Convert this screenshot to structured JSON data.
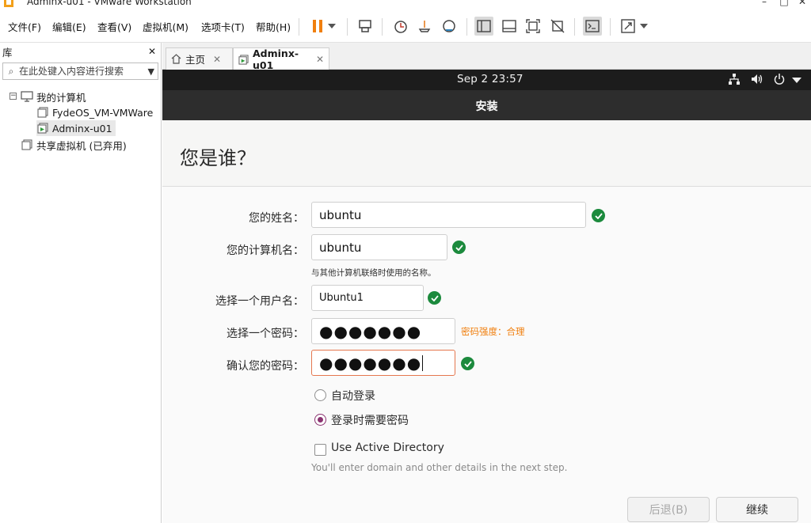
{
  "window": {
    "title": "Adminx-u01 - VMware Workstation",
    "minimize": "–",
    "maximize": "□",
    "close": "✕"
  },
  "menubar": {
    "items": [
      {
        "label": "文件(F)"
      },
      {
        "label": "编辑(E)"
      },
      {
        "label": "查看(V)"
      },
      {
        "label": "虚拟机(M)"
      },
      {
        "label": "选项卡(T)"
      },
      {
        "label": "帮助(H)"
      }
    ]
  },
  "library": {
    "title": "库",
    "close": "✕",
    "search_placeholder": "在此处键入内容进行搜索",
    "tree": {
      "root": "我的计算机",
      "vms": [
        "FydeOS_VM-VMWare",
        "Adminx-u01"
      ],
      "shared": "共享虚拟机 (已弃用)"
    }
  },
  "tabs": [
    {
      "label": "主页"
    },
    {
      "label": "Adminx-u01"
    }
  ],
  "guest": {
    "clock": "Sep 2  23:57",
    "header_title": "安装",
    "page_title": "您是谁？",
    "fields": {
      "name_label": "您的姓名：",
      "name_value": "ubuntu",
      "hostname_label": "您的计算机名：",
      "hostname_value": "ubuntu",
      "hostname_hint": "与其他计算机联络时使用的名称。",
      "username_label": "选择一个用户名：",
      "username_value": "Ubuntu1",
      "password_label": "选择一个密码：",
      "password_value": "●●●●●●●",
      "password_strength": "密码强度：合理",
      "confirm_label": "确认您的密码：",
      "confirm_value": "●●●●●●●"
    },
    "options": {
      "auto_login": "自动登录",
      "require_password": "登录时需要密码",
      "active_directory": "Use Active Directory",
      "ad_hint": "You'll enter domain and other details in the next step."
    },
    "buttons": {
      "back": "后退(B)",
      "continue": "继续"
    }
  }
}
